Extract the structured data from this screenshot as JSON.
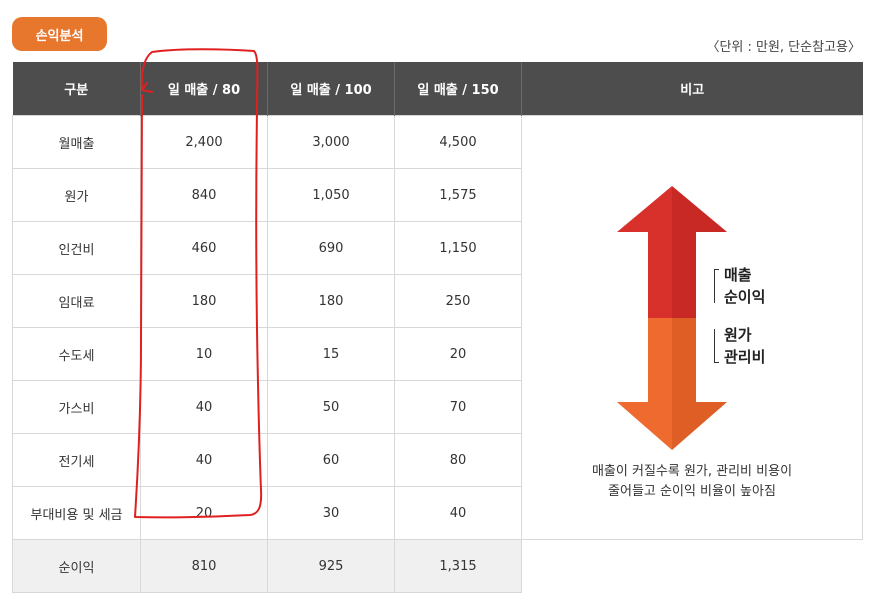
{
  "badge": "손익분석",
  "unit_note": "〈단위 : 만원, 단순참고용〉",
  "table": {
    "headers": [
      "구분",
      "일 매출 / 80",
      "일 매출 / 100",
      "일 매출 / 150",
      "비고"
    ],
    "rows": [
      [
        "월매출",
        "2,400",
        "3,000",
        "4,500"
      ],
      [
        "원가",
        "840",
        "1,050",
        "1,575"
      ],
      [
        "인건비",
        "460",
        "690",
        "1,150"
      ],
      [
        "임대료",
        "180",
        "180",
        "250"
      ],
      [
        "수도세",
        "10",
        "15",
        "20"
      ],
      [
        "가스비",
        "40",
        "50",
        "70"
      ],
      [
        "전기세",
        "40",
        "60",
        "80"
      ],
      [
        "부대비용 및 세금",
        "20",
        "30",
        "40"
      ]
    ],
    "total": [
      "순이익",
      "810",
      "925",
      "1,315"
    ]
  },
  "remark": {
    "legend_up": [
      "매출",
      "순이익"
    ],
    "legend_down": [
      "원가",
      "관리비"
    ],
    "caption_lines": [
      "매출이 커질수록 원가, 관리비 비용이",
      "줄어들고 순이익 비율이 높아짐"
    ],
    "colors": {
      "up_arrow": "#d8302b",
      "down_arrow": "#ee6a2e"
    }
  },
  "annotation": {
    "color": "#e02020",
    "icon": "red-hand-drawn-circle"
  }
}
